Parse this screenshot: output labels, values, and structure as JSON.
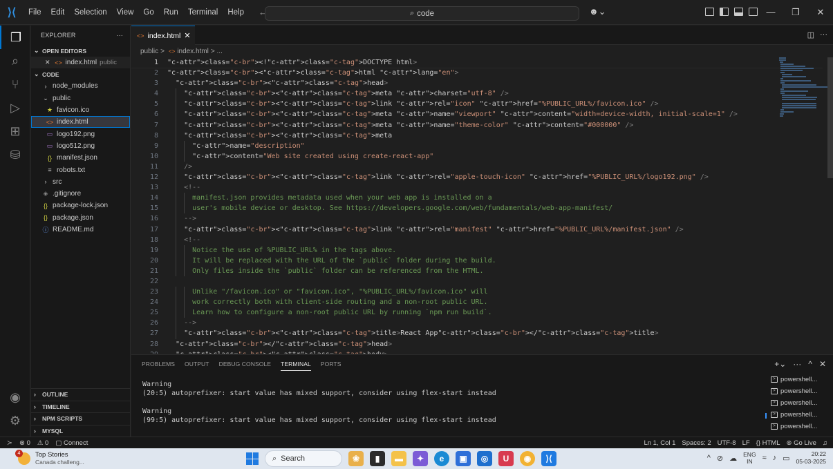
{
  "menu": [
    "File",
    "Edit",
    "Selection",
    "View",
    "Go",
    "Run",
    "Terminal",
    "Help"
  ],
  "nav": {
    "back": "←",
    "forward": "→"
  },
  "search": {
    "text": "code",
    "icon": "⌕"
  },
  "copilot_icon": "☻⌄",
  "window_controls": {
    "minimize": "—",
    "restore": "❐",
    "close": "✕"
  },
  "explorer": {
    "title": "EXPLORER",
    "more": "···",
    "open_editors_label": "OPEN EDITORS",
    "open_editor": {
      "close": "✕",
      "name": "index.html",
      "folder": "public"
    },
    "root_label": "CODE",
    "tree": [
      {
        "name": "node_modules",
        "kind": "folder",
        "chev": "›",
        "indent": 1
      },
      {
        "name": "public",
        "kind": "folder-open",
        "chev": "⌄",
        "indent": 1
      },
      {
        "name": "favicon.ico",
        "kind": "ico",
        "icon": "★",
        "indent": 2
      },
      {
        "name": "index.html",
        "kind": "html",
        "icon": "<>",
        "indent": 2,
        "selected": true
      },
      {
        "name": "logo192.png",
        "kind": "img",
        "icon": "▭",
        "indent": 2
      },
      {
        "name": "logo512.png",
        "kind": "img",
        "icon": "▭",
        "indent": 2
      },
      {
        "name": "manifest.json",
        "kind": "json",
        "icon": "{}",
        "indent": 2
      },
      {
        "name": "robots.txt",
        "kind": "txt",
        "icon": "≡",
        "indent": 2
      },
      {
        "name": "src",
        "kind": "folder",
        "chev": "›",
        "indent": 1
      },
      {
        "name": ".gitignore",
        "kind": "git",
        "icon": "◈",
        "indent": 1
      },
      {
        "name": "package-lock.json",
        "kind": "json",
        "icon": "{}",
        "indent": 1
      },
      {
        "name": "package.json",
        "kind": "json",
        "icon": "{}",
        "indent": 1
      },
      {
        "name": "README.md",
        "kind": "info",
        "icon": "ⓘ",
        "indent": 1
      }
    ],
    "bottom_sections": [
      "OUTLINE",
      "TIMELINE",
      "NPM SCRIPTS",
      "MYSQL"
    ]
  },
  "tab": {
    "icon": "<>",
    "label": "index.html",
    "close": "✕"
  },
  "breadcrumb": {
    "folder": "public",
    "sep": ">",
    "file": "index.html",
    "tail": "> ..."
  },
  "code_lines": [
    "<!DOCTYPE html>",
    "<html lang=\"en\">",
    "  <head>",
    "    <meta charset=\"utf-8\" />",
    "    <link rel=\"icon\" href=\"%PUBLIC_URL%/favicon.ico\" />",
    "    <meta name=\"viewport\" content=\"width=device-width, initial-scale=1\" />",
    "    <meta name=\"theme-color\" content=\"#000000\" />",
    "    <meta",
    "      name=\"description\"",
    "      content=\"Web site created using create-react-app\"",
    "    />",
    "    <link rel=\"apple-touch-icon\" href=\"%PUBLIC_URL%/logo192.png\" />",
    "    <!--",
    "      manifest.json provides metadata used when your web app is installed on a",
    "      user's mobile device or desktop. See https://developers.google.com/web/fundamentals/web-app-manifest/",
    "    -->",
    "    <link rel=\"manifest\" href=\"%PUBLIC_URL%/manifest.json\" />",
    "    <!--",
    "      Notice the use of %PUBLIC_URL% in the tags above.",
    "      It will be replaced with the URL of the `public` folder during the build.",
    "      Only files inside the `public` folder can be referenced from the HTML.",
    "",
    "      Unlike \"/favicon.ico\" or \"favicon.ico\", \"%PUBLIC_URL%/favicon.ico\" will",
    "      work correctly both with client-side routing and a non-root public URL.",
    "      Learn how to configure a non-root public URL by running `npm run build`.",
    "    -->",
    "    <title>React App</title>",
    "  </head>",
    "  <body>"
  ],
  "panel": {
    "tabs": [
      "PROBLEMS",
      "OUTPUT",
      "DEBUG CONSOLE",
      "TERMINAL",
      "PORTS"
    ],
    "active_tab": "TERMINAL",
    "actions": [
      "+⌄",
      "···",
      "^",
      "✕"
    ],
    "terminal_lines": [
      "Warning",
      "(20:5) autoprefixer: start value has mixed support, consider using flex-start instead",
      "",
      "Warning",
      "(99:5) autoprefixer: start value has mixed support, consider using flex-start instead"
    ],
    "terminals": [
      "powershell...",
      "powershell...",
      "powershell...",
      "powershell...",
      "powershell..."
    ]
  },
  "status": {
    "remote": "≻",
    "errors": "⊗ 0",
    "warnings": "⚠ 0",
    "connect": "Connect",
    "cursor": "Ln 1, Col 1",
    "spaces": "Spaces: 2",
    "encoding": "UTF-8",
    "eol": "LF",
    "language": "{} HTML",
    "golive": "Go Live",
    "bell": "🔔"
  },
  "taskbar": {
    "news_badge": "4",
    "news_title": "Top Stories",
    "news_sub": "Canada challeng...",
    "search_label": "Search",
    "lang_top": "ENG",
    "lang_bottom": "IN",
    "time": "20:22",
    "date": "05-03-2025"
  },
  "colors": {
    "accent": "#0078d4",
    "html_icon": "#e37933",
    "tag": "#569cd6",
    "attr": "#9cdcfe",
    "string": "#ce9178",
    "comment": "#6a9955"
  }
}
